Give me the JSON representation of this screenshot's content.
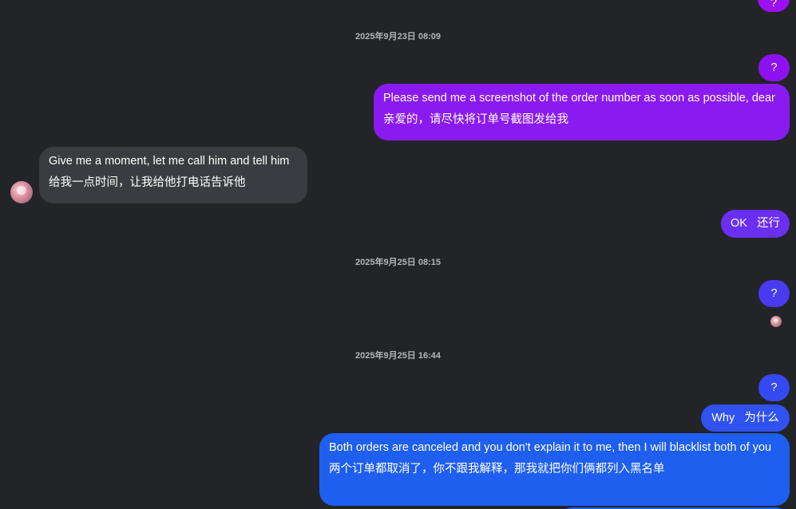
{
  "timestamps": [
    "2025年9月23日 08:09",
    "2025年9月25日 08:15",
    "2025年9月25日 16:44"
  ],
  "messages": {
    "top_partial": "?",
    "q1": "?",
    "screenshot_en": "Please send me a screenshot of the order number as soon as possible, dear",
    "screenshot_zh": "亲爱的，请尽快将订单号截图发给我",
    "moment_en": "Give me a moment, let me call him and tell him",
    "moment_zh": "给我一点时间，让我给他打电话告诉他",
    "ok": "OK   还行",
    "q2": "?",
    "q3": "?",
    "why": "Why   为什么",
    "cancel_en": "Both orders are canceled and you don't explain it to me, then I will blacklist both of you",
    "cancel_zh": "两个订单都取消了，你不跟我解释，那我就把你们俩都列入黑名单"
  },
  "colors": {
    "background": "#232428",
    "incoming_bubble": "#3b3c41",
    "outgoing_violet": "#8a1bf0",
    "outgoing_purple": "#6a2ff0",
    "outgoing_indigo": "#4a3af0",
    "outgoing_blue": "#2f52f0",
    "outgoing_brightblue": "#1f5ff0"
  }
}
